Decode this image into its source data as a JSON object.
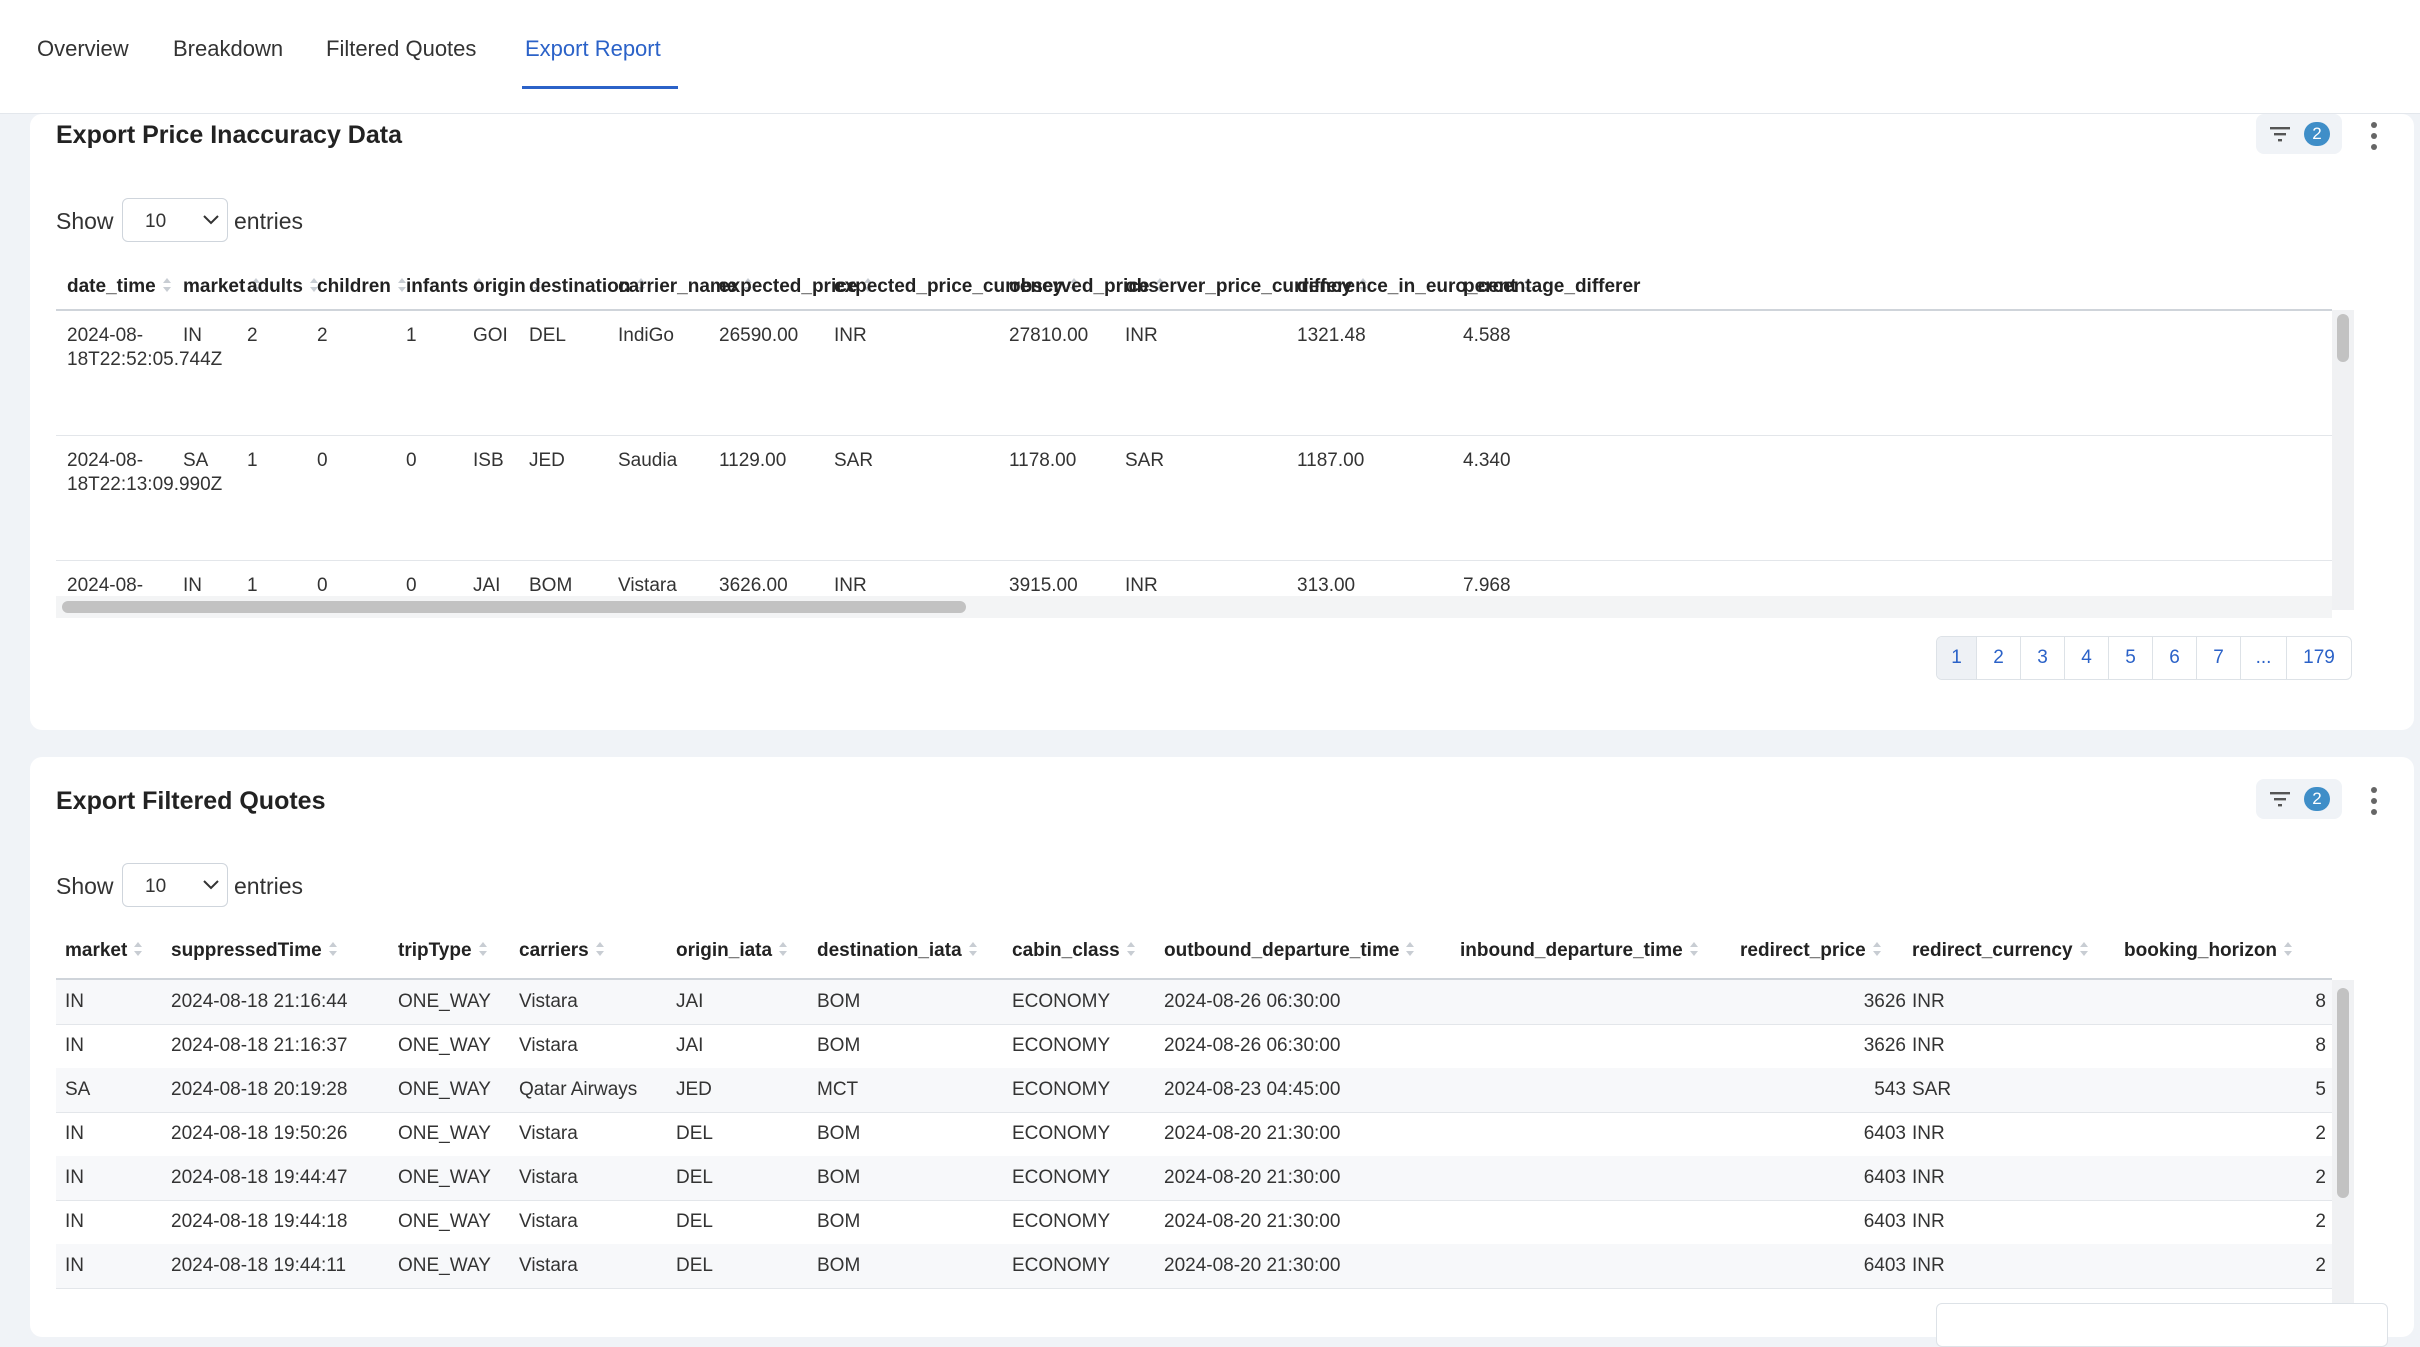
{
  "tabs": [
    {
      "label": "Overview"
    },
    {
      "label": "Breakdown"
    },
    {
      "label": "Filtered Quotes"
    },
    {
      "label": "Export Report"
    }
  ],
  "active_tab": "Export Report",
  "colors": {
    "accent": "#2b62c8",
    "badge": "#3f8ec8"
  },
  "show_label": "Show",
  "entries_label": "entries",
  "inaccuracy": {
    "title": "Export Price Inaccuracy Data",
    "filter_count": "2",
    "page_size": "10",
    "columns": [
      "date_time",
      "market",
      "adults",
      "children",
      "infants",
      "origin",
      "destination",
      "carrier_name",
      "expected_price",
      "expected_price_currency",
      "observed_price",
      "observer_price_currency",
      "difference_in_euro_cent",
      "percentage_differer"
    ],
    "rows": [
      [
        "2024-08-18T22:52:05.744Z",
        "IN",
        "2",
        "2",
        "1",
        "GOI",
        "DEL",
        "IndiGo",
        "26590.00",
        "INR",
        "27810.00",
        "INR",
        "1321.48",
        "4.588"
      ],
      [
        "2024-08-18T22:13:09.990Z",
        "SA",
        "1",
        "0",
        "0",
        "ISB",
        "JED",
        "Saudia",
        "1129.00",
        "SAR",
        "1178.00",
        "SAR",
        "1187.00",
        "4.340"
      ],
      [
        "2024-08-",
        "IN",
        "1",
        "0",
        "0",
        "JAI",
        "BOM",
        "Vistara",
        "3626.00",
        "INR",
        "3915.00",
        "INR",
        "313.00",
        "7.968"
      ]
    ],
    "pages": [
      "1",
      "2",
      "3",
      "4",
      "5",
      "6",
      "7",
      "...",
      "179"
    ]
  },
  "filtered": {
    "title": "Export Filtered Quotes",
    "filter_count": "2",
    "page_size": "10",
    "columns": [
      "market",
      "suppressedTime",
      "tripType",
      "carriers",
      "origin_iata",
      "destination_iata",
      "cabin_class",
      "outbound_departure_time",
      "inbound_departure_time",
      "redirect_price",
      "redirect_currency",
      "booking_horizon"
    ],
    "rows": [
      [
        "IN",
        "2024-08-18 21:16:44",
        "ONE_WAY",
        "Vistara",
        "JAI",
        "BOM",
        "ECONOMY",
        "2024-08-26 06:30:00",
        "",
        "3626",
        "INR",
        "8"
      ],
      [
        "IN",
        "2024-08-18 21:16:37",
        "ONE_WAY",
        "Vistara",
        "JAI",
        "BOM",
        "ECONOMY",
        "2024-08-26 06:30:00",
        "",
        "3626",
        "INR",
        "8"
      ],
      [
        "SA",
        "2024-08-18 20:19:28",
        "ONE_WAY",
        "Qatar Airways",
        "JED",
        "MCT",
        "ECONOMY",
        "2024-08-23 04:45:00",
        "",
        "543",
        "SAR",
        "5"
      ],
      [
        "IN",
        "2024-08-18 19:50:26",
        "ONE_WAY",
        "Vistara",
        "DEL",
        "BOM",
        "ECONOMY",
        "2024-08-20 21:30:00",
        "",
        "6403",
        "INR",
        "2"
      ],
      [
        "IN",
        "2024-08-18 19:44:47",
        "ONE_WAY",
        "Vistara",
        "DEL",
        "BOM",
        "ECONOMY",
        "2024-08-20 21:30:00",
        "",
        "6403",
        "INR",
        "2"
      ],
      [
        "IN",
        "2024-08-18 19:44:18",
        "ONE_WAY",
        "Vistara",
        "DEL",
        "BOM",
        "ECONOMY",
        "2024-08-20 21:30:00",
        "",
        "6403",
        "INR",
        "2"
      ],
      [
        "IN",
        "2024-08-18 19:44:11",
        "ONE_WAY",
        "Vistara",
        "DEL",
        "BOM",
        "ECONOMY",
        "2024-08-20 21:30:00",
        "",
        "6403",
        "INR",
        "2"
      ]
    ]
  }
}
